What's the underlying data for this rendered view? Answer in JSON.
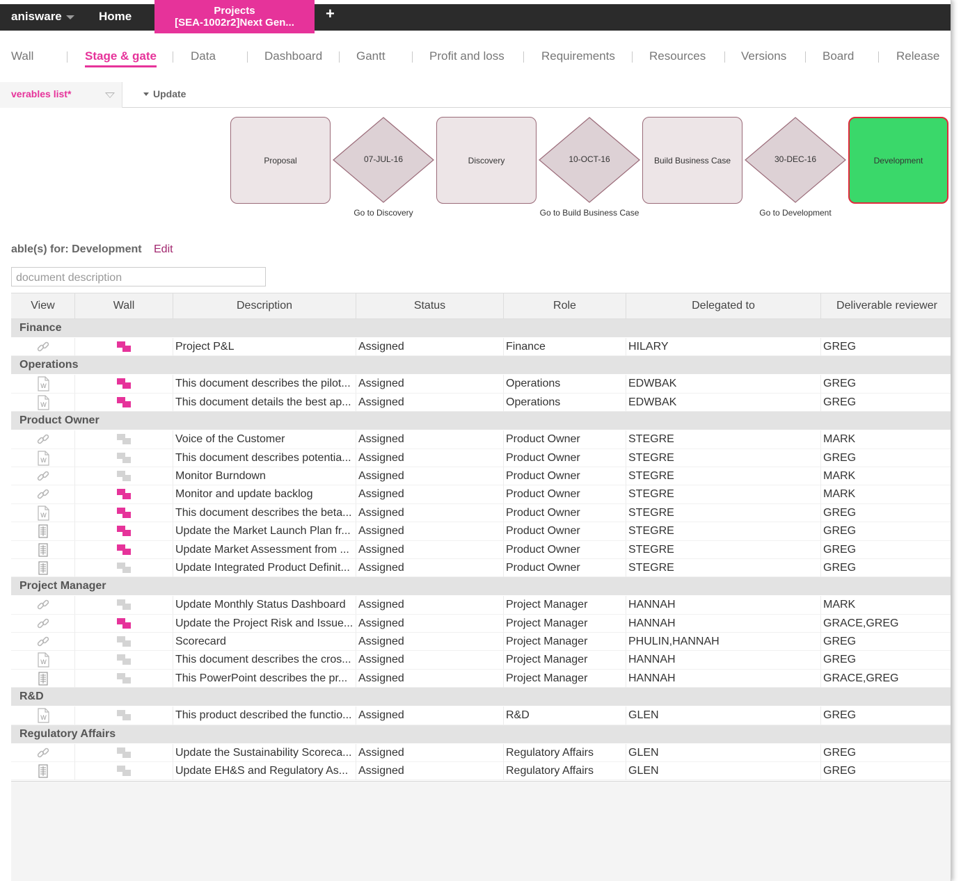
{
  "app": {
    "brand": "anisware",
    "home": "Home",
    "project_tab_line1": "Projects",
    "project_tab_line2": "[SEA-1002r2]Next Gen...",
    "add_tab": "+"
  },
  "nav": {
    "items": [
      {
        "label": "Wall",
        "active": false
      },
      {
        "label": "Stage & gate",
        "active": true
      },
      {
        "label": "Data",
        "active": false
      },
      {
        "label": "Dashboard",
        "active": false
      },
      {
        "label": "Gantt",
        "active": false
      },
      {
        "label": "Profit and loss",
        "active": false
      },
      {
        "label": "Requirements",
        "active": false
      },
      {
        "label": "Resources",
        "active": false
      },
      {
        "label": "Versions",
        "active": false
      },
      {
        "label": "Board",
        "active": false
      },
      {
        "label": "Release",
        "active": false
      }
    ]
  },
  "toolbar": {
    "view_selected": "verables list*",
    "update_label": "Update"
  },
  "flow": {
    "stages": [
      {
        "label": "Proposal",
        "current": false
      },
      {
        "label": "Discovery",
        "current": false
      },
      {
        "label": "Build Business Case",
        "current": false
      },
      {
        "label": "Development",
        "current": true
      }
    ],
    "gates": [
      {
        "date": "07-JUL-16",
        "caption": "Go to Discovery"
      },
      {
        "date": "10-OCT-16",
        "caption": "Go to Build Business Case"
      },
      {
        "date": "30-DEC-16",
        "caption": "Go to Development"
      }
    ]
  },
  "deliverables": {
    "title": "able(s) for: Development",
    "edit_label": "Edit",
    "filter_placeholder": "document description",
    "columns": [
      "View",
      "Wall",
      "Description",
      "Status",
      "Role",
      "Delegated to",
      "Deliverable reviewer"
    ],
    "groups": [
      {
        "name": "Finance",
        "rows": [
          {
            "view": "link",
            "wall": true,
            "description": "Project P&L",
            "status": "Assigned",
            "role": "Finance",
            "delegated": "HILARY",
            "reviewer": "GREG"
          }
        ]
      },
      {
        "name": "Operations",
        "rows": [
          {
            "view": "word",
            "wall": true,
            "description": "This document describes the pilot...",
            "status": "Assigned",
            "role": "Operations",
            "delegated": "EDWBAK",
            "reviewer": "GREG"
          },
          {
            "view": "word",
            "wall": true,
            "description": "This document details the best ap...",
            "status": "Assigned",
            "role": "Operations",
            "delegated": "EDWBAK",
            "reviewer": "GREG"
          }
        ]
      },
      {
        "name": "Product Owner",
        "rows": [
          {
            "view": "link",
            "wall": false,
            "description": "Voice of the Customer",
            "status": "Assigned",
            "role": "Product Owner",
            "delegated": "STEGRE",
            "reviewer": "MARK"
          },
          {
            "view": "word",
            "wall": false,
            "description": "This document describes potentia...",
            "status": "Assigned",
            "role": "Product Owner",
            "delegated": "STEGRE",
            "reviewer": "GREG"
          },
          {
            "view": "link",
            "wall": false,
            "description": "Monitor Burndown",
            "status": "Assigned",
            "role": "Product Owner",
            "delegated": "STEGRE",
            "reviewer": "MARK"
          },
          {
            "view": "link",
            "wall": true,
            "description": "Monitor and update backlog",
            "status": "Assigned",
            "role": "Product Owner",
            "delegated": "STEGRE",
            "reviewer": "MARK"
          },
          {
            "view": "word",
            "wall": true,
            "description": "This document describes the beta...",
            "status": "Assigned",
            "role": "Product Owner",
            "delegated": "STEGRE",
            "reviewer": "GREG"
          },
          {
            "view": "form",
            "wall": true,
            "description": "Update the Market Launch Plan fr...",
            "status": "Assigned",
            "role": "Product Owner",
            "delegated": "STEGRE",
            "reviewer": "GREG"
          },
          {
            "view": "form",
            "wall": true,
            "description": "Update Market Assessment from ...",
            "status": "Assigned",
            "role": "Product Owner",
            "delegated": "STEGRE",
            "reviewer": "GREG"
          },
          {
            "view": "form",
            "wall": false,
            "description": "Update Integrated Product Definit...",
            "status": "Assigned",
            "role": "Product Owner",
            "delegated": "STEGRE",
            "reviewer": "GREG"
          }
        ]
      },
      {
        "name": "Project Manager",
        "rows": [
          {
            "view": "link",
            "wall": false,
            "description": "Update Monthly Status Dashboard",
            "status": "Assigned",
            "role": "Project Manager",
            "delegated": "HANNAH",
            "reviewer": "MARK"
          },
          {
            "view": "link",
            "wall": true,
            "description": "Update the Project Risk and Issue...",
            "status": "Assigned",
            "role": "Project Manager",
            "delegated": "HANNAH",
            "reviewer": "GRACE,GREG"
          },
          {
            "view": "link",
            "wall": false,
            "description": "Scorecard",
            "status": "Assigned",
            "role": "Project Manager",
            "delegated": "PHULIN,HANNAH",
            "reviewer": "GREG"
          },
          {
            "view": "word",
            "wall": false,
            "description": "This document describes the cros...",
            "status": "Assigned",
            "role": "Project Manager",
            "delegated": "HANNAH",
            "reviewer": "GREG"
          },
          {
            "view": "form",
            "wall": false,
            "description": "This PowerPoint describes the pr...",
            "status": "Assigned",
            "role": "Project Manager",
            "delegated": "HANNAH",
            "reviewer": "GRACE,GREG"
          }
        ]
      },
      {
        "name": "R&D",
        "rows": [
          {
            "view": "word",
            "wall": false,
            "description": "This product described the functio...",
            "status": "Assigned",
            "role": "R&D",
            "delegated": "GLEN",
            "reviewer": "GREG"
          }
        ]
      },
      {
        "name": "Regulatory Affairs",
        "rows": [
          {
            "view": "link",
            "wall": false,
            "description": "Update the Sustainability Scoreca...",
            "status": "Assigned",
            "role": "Regulatory Affairs",
            "delegated": "GLEN",
            "reviewer": "GREG"
          },
          {
            "view": "form",
            "wall": false,
            "description": "Update EH&S and Regulatory As...",
            "status": "Assigned",
            "role": "Regulatory Affairs",
            "delegated": "GLEN",
            "reviewer": "GREG"
          }
        ]
      }
    ]
  },
  "colors": {
    "accent": "#e6339a",
    "topbar": "#2b2b2b",
    "current_stage": "#3ad86a",
    "current_stage_border": "#e02a3c",
    "stage_fill": "#ede5e7",
    "gate_fill": "#ddd1d5"
  }
}
